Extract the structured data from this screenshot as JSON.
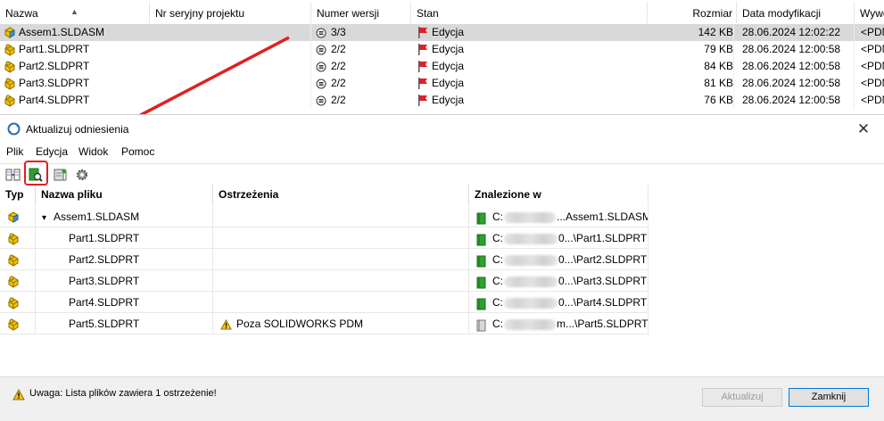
{
  "file_list": {
    "columns": [
      "Nazwa",
      "Nr seryjny projektu",
      "Numer wersji",
      "Stan",
      "Rozmiar",
      "Data modyfikacji",
      "Wywe"
    ],
    "rows": [
      {
        "name": "Assem1.SLDASM",
        "version": "3/3",
        "state": "Edycja",
        "size": "142 KB",
        "date": "28.06.2024 12:02:22",
        "extra": "<PDM",
        "type": "assembly"
      },
      {
        "name": "Part1.SLDPRT",
        "version": "2/2",
        "state": "Edycja",
        "size": "79 KB",
        "date": "28.06.2024 12:00:58",
        "extra": "<PDM",
        "type": "part"
      },
      {
        "name": "Part2.SLDPRT",
        "version": "2/2",
        "state": "Edycja",
        "size": "84 KB",
        "date": "28.06.2024 12:00:58",
        "extra": "<PDM",
        "type": "part"
      },
      {
        "name": "Part3.SLDPRT",
        "version": "2/2",
        "state": "Edycja",
        "size": "81 KB",
        "date": "28.06.2024 12:00:58",
        "extra": "<PDM",
        "type": "part"
      },
      {
        "name": "Part4.SLDPRT",
        "version": "2/2",
        "state": "Edycja",
        "size": "76 KB",
        "date": "28.06.2024 12:00:58",
        "extra": "<PDM",
        "type": "part"
      }
    ]
  },
  "dialog": {
    "title": "Aktualizuj odniesienia",
    "close_label": "✕",
    "menu": [
      "Plik",
      "Edycja",
      "Widok",
      "Pomoc"
    ],
    "toolbar_icons": [
      "columns-icon",
      "find-references-icon",
      "database-icon",
      "settings-gear-icon"
    ],
    "grid": {
      "headers": [
        "Typ",
        "Nazwa pliku",
        "Ostrzeżenia",
        "Znalezione w"
      ],
      "rows": [
        {
          "type": "assembly",
          "name": "Assem1.SLDASM",
          "expander": "▾",
          "warning": "",
          "found_prefix": "C:",
          "found_suffix": "...Assem1.SLDASM",
          "vault": true
        },
        {
          "type": "part",
          "name": "Part1.SLDPRT",
          "warning": "",
          "found_prefix": "C:",
          "found_suffix": "0...\\Part1.SLDPRT",
          "vault": true
        },
        {
          "type": "part",
          "name": "Part2.SLDPRT",
          "warning": "",
          "found_prefix": "C:",
          "found_suffix": "0...\\Part2.SLDPRT",
          "vault": true
        },
        {
          "type": "part",
          "name": "Part3.SLDPRT",
          "warning": "",
          "found_prefix": "C:",
          "found_suffix": "0...\\Part3.SLDPRT",
          "vault": true
        },
        {
          "type": "part",
          "name": "Part4.SLDPRT",
          "warning": "",
          "found_prefix": "C:",
          "found_suffix": "0...\\Part4.SLDPRT",
          "vault": true
        },
        {
          "type": "part",
          "name": "Part5.SLDPRT",
          "warning": "Poza SOLIDWORKS PDM",
          "found_prefix": "C:",
          "found_suffix": "m...\\Part5.SLDPRT",
          "vault": false
        }
      ]
    },
    "status_warning": "Uwaga: Lista plików zawiera 1 ostrzeżenie!",
    "update_button": "Aktualizuj",
    "close_button": "Zamknij"
  },
  "colors": {
    "state_flag": "#e0202c",
    "arrow": "#e02020",
    "part_icon": "#e6b400",
    "found_green": "#2fa02f"
  }
}
